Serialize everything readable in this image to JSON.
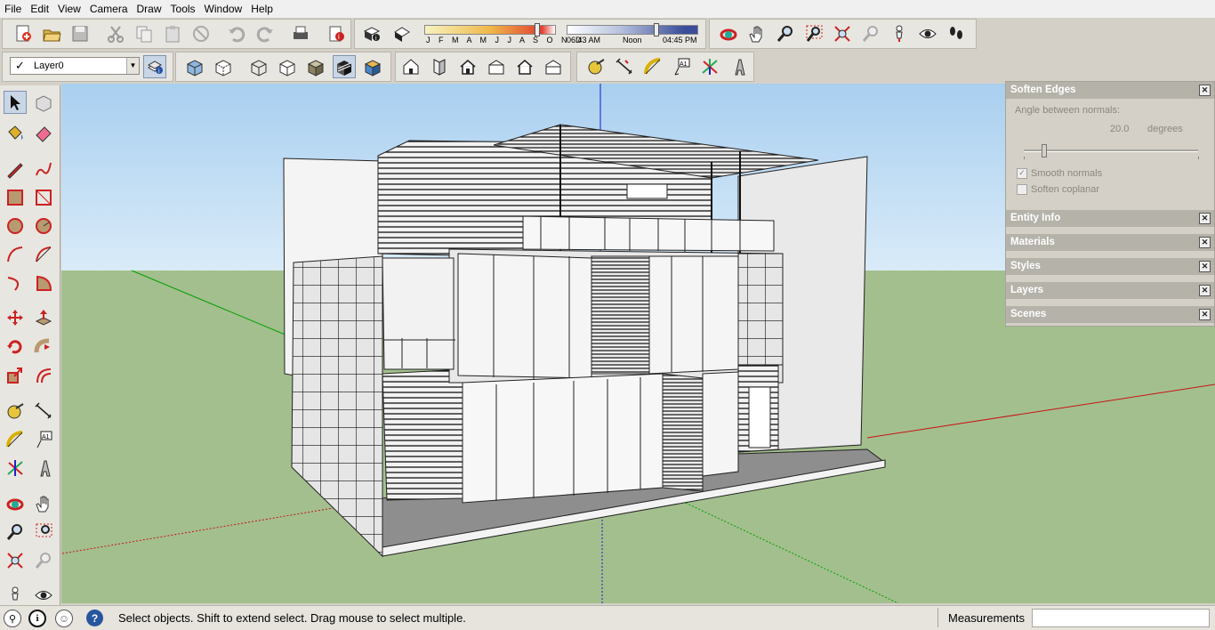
{
  "menu": [
    "File",
    "Edit",
    "View",
    "Camera",
    "Draw",
    "Tools",
    "Window",
    "Help"
  ],
  "shadow": {
    "months": "J F M A M J J A S O N D",
    "sunrise": "06:43 AM",
    "noon": "Noon",
    "sunset": "04:45 PM"
  },
  "layer": {
    "current": "Layer0"
  },
  "tray": {
    "soften": {
      "title": "Soften Edges",
      "angle_label": "Angle between normals:",
      "angle_value": "20.0",
      "angle_unit": "degrees",
      "smooth_normals": "Smooth normals",
      "soften_coplanar": "Soften coplanar"
    },
    "panels": [
      "Entity Info",
      "Materials",
      "Styles",
      "Layers",
      "Scenes"
    ],
    "close_symbol": "✕"
  },
  "status": {
    "message": "Select objects. Shift to extend select. Drag mouse to select multiple.",
    "measurements_label": "Measurements",
    "measurements_value": ""
  },
  "colors": {
    "sky": "#bbd9f1",
    "ground": "#a3bf8e",
    "red_axis": "#c81414",
    "green_axis": "#00a000",
    "blue_axis": "#1818c8"
  }
}
